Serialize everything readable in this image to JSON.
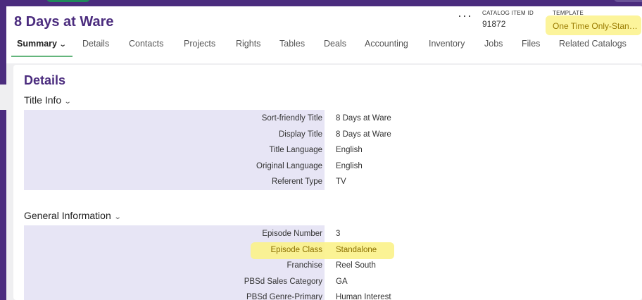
{
  "header": {
    "title": "8 Days at Ware",
    "more_label": "···",
    "catalog_item_id_label": "CATALOG ITEM ID",
    "catalog_item_id": "91872",
    "template_label": "TEMPLATE",
    "template_value": "One Time Only-Stan…"
  },
  "tabs": [
    {
      "label": "Summary",
      "active": true
    },
    {
      "label": "Details"
    },
    {
      "label": "Contacts"
    },
    {
      "label": "Projects"
    },
    {
      "label": "Rights"
    },
    {
      "label": "Tables"
    },
    {
      "label": "Deals"
    },
    {
      "label": "Accounting"
    },
    {
      "label": "Inventory"
    },
    {
      "label": "Jobs"
    },
    {
      "label": "Files"
    },
    {
      "label": "Related Catalogs"
    }
  ],
  "content": {
    "heading": "Details",
    "sections": [
      {
        "title": "Title Info",
        "fields": [
          {
            "label": "Sort-friendly Title",
            "value": "8 Days at Ware"
          },
          {
            "label": "Display Title",
            "value": "8 Days at Ware"
          },
          {
            "label": "Title Language",
            "value": "English"
          },
          {
            "label": "Original Language",
            "value": "English"
          },
          {
            "label": "Referent Type",
            "value": "TV"
          }
        ]
      },
      {
        "title": "General Information",
        "fields": [
          {
            "label": "Episode Number",
            "value": "3"
          },
          {
            "label": "Episode Class",
            "value": "Standalone",
            "highlighted": true
          },
          {
            "label": "Franchise",
            "value": "Reel South"
          },
          {
            "label": "PBSd Sales Category",
            "value": "GA"
          },
          {
            "label": "PBSd Genre-Primary",
            "value": "Human Interest"
          }
        ]
      }
    ]
  },
  "colors": {
    "brand_purple": "#4b2c7e",
    "highlight_yellow": "#fbf28a",
    "tab_underline": "#63b57c",
    "field_label_bg": "#e7e5f5"
  }
}
